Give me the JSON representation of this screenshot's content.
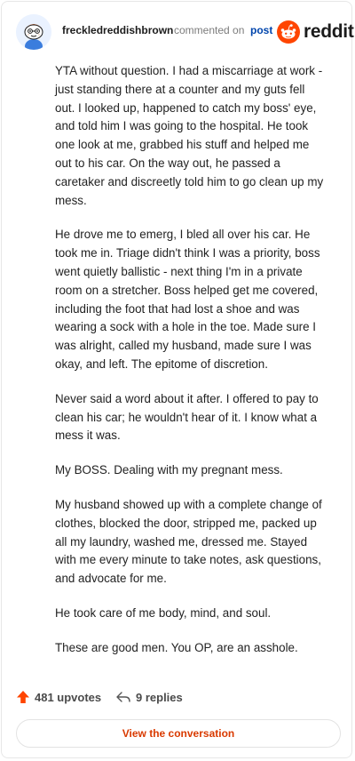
{
  "header": {
    "username": "freckledreddishbrown",
    "action_text": "commented on",
    "post_link": "post",
    "brand_name": "reddit"
  },
  "comment": {
    "paragraphs": [
      "YTA without question. I had a miscarriage at work - just standing there at a counter and my guts fell out. I looked up, happened to catch my boss' eye, and told him I was going to the hospital. He took one look at me, grabbed his stuff and helped me out to his car. On the way out, he passed a caretaker and discreetly told him to go clean up my mess.",
      "He drove me to emerg, I bled all over his car. He took me in. Triage didn't think I was a priority, boss went quietly ballistic - next thing I'm in a private room on a stretcher. Boss helped get me covered, including the foot that had lost a shoe and was wearing a sock with a hole in the toe. Made sure I was alright, called my husband, made sure I was okay, and left. The epitome of discretion.",
      "Never said a word about it after. I offered to pay to clean his car; he wouldn't hear of it. I know what a mess it was.",
      "My BOSS. Dealing with my pregnant mess.",
      "My husband showed up with a complete change of clothes, blocked the door, stripped me, packed up all my laundry, washed me, dressed me. Stayed with me every minute to take notes, ask questions, and advocate for me.",
      "He took care of me body, mind, and soul.",
      "These are good men. You OP, are an asshole."
    ]
  },
  "footer": {
    "upvotes_label": "481 upvotes",
    "replies_label": "9 replies",
    "view_button": "View the conversation"
  },
  "icons": {
    "upvote": "upvote-arrow-icon",
    "reply": "reply-arrow-icon",
    "logo": "reddit-snoo-icon",
    "avatar": "snoo-avatar"
  },
  "colors": {
    "brand": "#ff4500",
    "link": "#0045ac",
    "view_button_text": "#d93a00",
    "muted": "#7c7c7c"
  }
}
